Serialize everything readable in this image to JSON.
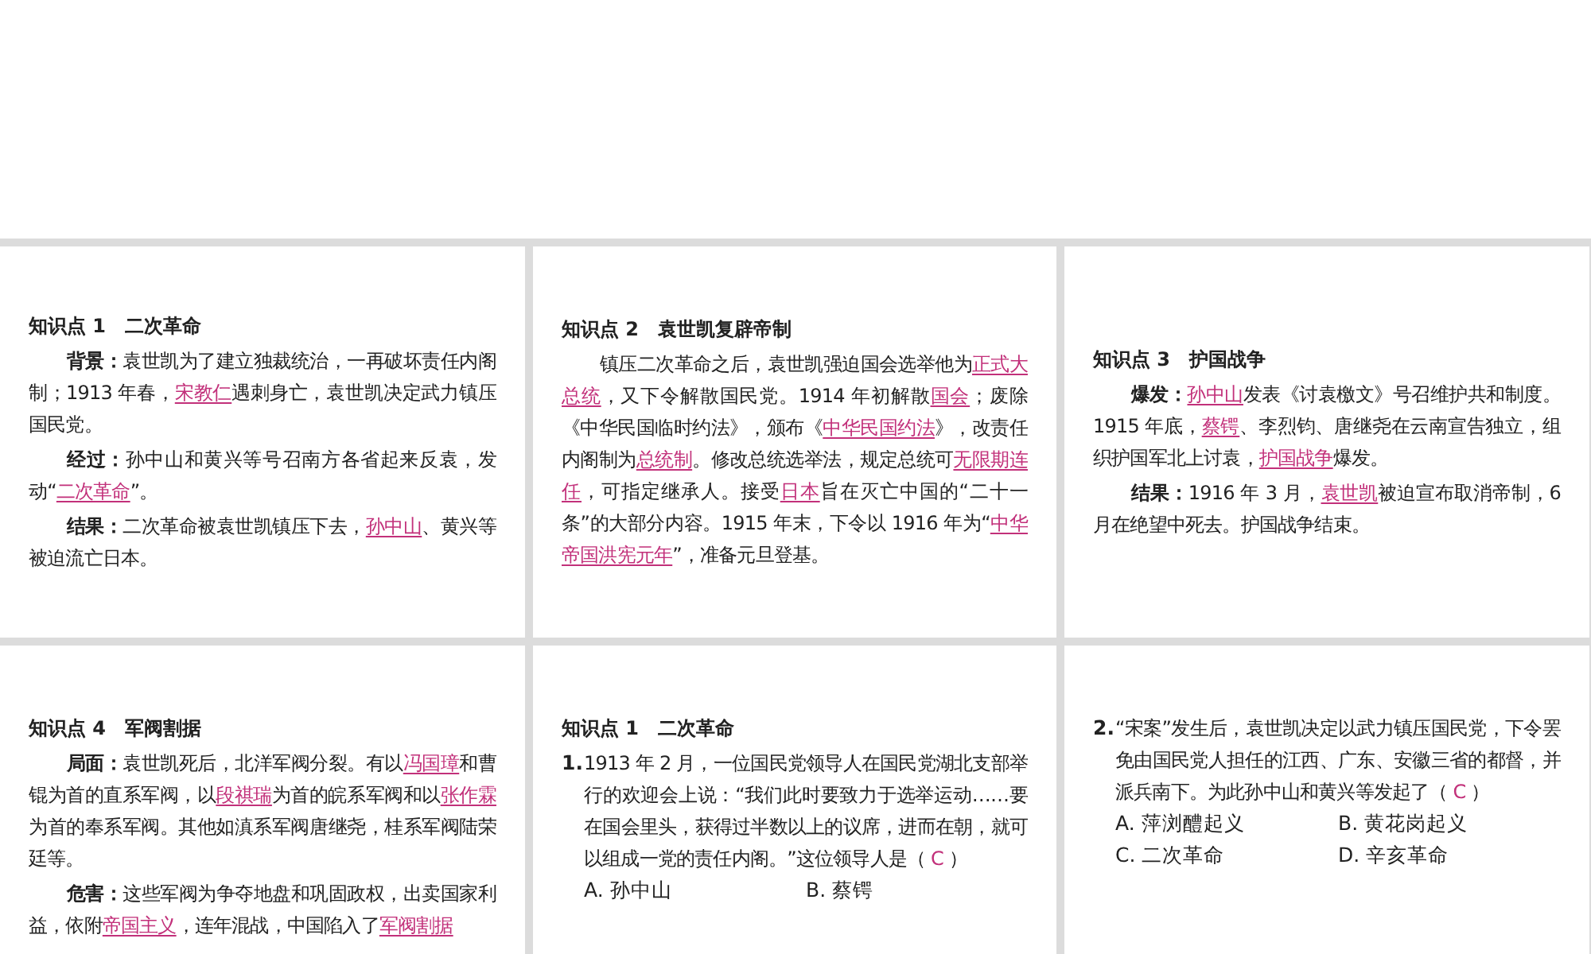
{
  "rows": [
    {
      "kind": "full",
      "panels": [
        {
          "blocks": [
            {
              "kind": "heading",
              "text": "知识点 1　二次革命"
            },
            {
              "kind": "paragraph",
              "segments": [
                {
                  "kind": "lead",
                  "text": "背景："
                },
                {
                  "kind": "plain",
                  "text": "袁世凯为了建立独裁统治，一再破坏责任内阁制；1913 年春，"
                },
                {
                  "kind": "key",
                  "text": "宋教仁"
                },
                {
                  "kind": "plain",
                  "text": "遇刺身亡，袁世凯决定武力镇压国民党。"
                }
              ]
            },
            {
              "kind": "paragraph",
              "segments": [
                {
                  "kind": "lead",
                  "text": "经过："
                },
                {
                  "kind": "plain",
                  "text": "孙中山和黄兴等号召南方各省起来反袁，发动“"
                },
                {
                  "kind": "key",
                  "text": "二次革命"
                },
                {
                  "kind": "plain",
                  "text": "”。"
                }
              ]
            },
            {
              "kind": "paragraph",
              "segments": [
                {
                  "kind": "lead",
                  "text": "结果："
                },
                {
                  "kind": "plain",
                  "text": "二次革命被袁世凯镇压下去，"
                },
                {
                  "kind": "key",
                  "text": "孙中山"
                },
                {
                  "kind": "plain",
                  "text": "、黄兴等被迫流亡日本。"
                }
              ]
            }
          ]
        },
        {
          "blocks": [
            {
              "kind": "heading",
              "text": "知识点 2　袁世凯复辟帝制"
            },
            {
              "kind": "paragraph",
              "segments": [
                {
                  "kind": "plain",
                  "text": "镇压二次革命之后，袁世凯强迫国会选举他为"
                },
                {
                  "kind": "key",
                  "text": "正式大总统"
                },
                {
                  "kind": "plain",
                  "text": "，又下令解散国民党。1914 年初解散"
                },
                {
                  "kind": "key",
                  "text": "国会"
                },
                {
                  "kind": "plain",
                  "text": "；废除《中华民国临时约法》，颁布《"
                },
                {
                  "kind": "key",
                  "text": "中华民国约法"
                },
                {
                  "kind": "plain",
                  "text": "》，改责任内阁制为"
                },
                {
                  "kind": "key",
                  "text": "总统制"
                },
                {
                  "kind": "plain",
                  "text": "。修改总统选举法，规定总统可"
                },
                {
                  "kind": "key",
                  "text": "无限期连任"
                },
                {
                  "kind": "plain",
                  "text": "，可指定继承人。接受"
                },
                {
                  "kind": "key",
                  "text": "日本"
                },
                {
                  "kind": "plain",
                  "text": "旨在灭亡中国的“二十一条”的大部分内容。1915 年末，下令以 1916 年为“"
                },
                {
                  "kind": "key",
                  "text": "中华帝国洪宪元年"
                },
                {
                  "kind": "plain",
                  "text": "”，准备元旦登基。"
                }
              ]
            }
          ]
        },
        {
          "blocks": [
            {
              "kind": "heading",
              "text": "知识点 3　护国战争"
            },
            {
              "kind": "paragraph",
              "segments": [
                {
                  "kind": "lead",
                  "text": "爆发："
                },
                {
                  "kind": "key",
                  "text": "孙中山"
                },
                {
                  "kind": "plain",
                  "text": "发表《讨袁檄文》号召维护共和制度。1915 年底，"
                },
                {
                  "kind": "key",
                  "text": "蔡锷"
                },
                {
                  "kind": "plain",
                  "text": "、李烈钧、唐继尧在云南宣告独立，组织护国军北上讨袁，"
                },
                {
                  "kind": "key",
                  "text": "护国战争"
                },
                {
                  "kind": "plain",
                  "text": "爆发。"
                }
              ]
            },
            {
              "kind": "paragraph",
              "segments": [
                {
                  "kind": "lead",
                  "text": "结果："
                },
                {
                  "kind": "plain",
                  "text": "1916 年 3 月，"
                },
                {
                  "kind": "key",
                  "text": "袁世凯"
                },
                {
                  "kind": "plain",
                  "text": "被迫宣布取消帝制，6 月在绝望中死去。护国战争结束。"
                }
              ]
            }
          ]
        }
      ]
    },
    {
      "kind": "cut",
      "panels": [
        {
          "blocks": [
            {
              "kind": "heading",
              "text": "知识点 4　军阀割据"
            },
            {
              "kind": "paragraph",
              "segments": [
                {
                  "kind": "lead",
                  "text": "局面："
                },
                {
                  "kind": "plain",
                  "text": "袁世凯死后，北洋军阀分裂。有以"
                },
                {
                  "kind": "key",
                  "text": "冯国璋"
                },
                {
                  "kind": "plain",
                  "text": "和曹锟为首的直系军阀，以"
                },
                {
                  "kind": "key",
                  "text": "段祺瑞"
                },
                {
                  "kind": "plain",
                  "text": "为首的皖系军阀和以"
                },
                {
                  "kind": "key",
                  "text": "张作霖"
                },
                {
                  "kind": "plain",
                  "text": "为首的奉系军阀。其他如滇系军阀唐继尧，桂系军阀陆荣廷等。"
                }
              ]
            },
            {
              "kind": "paragraph",
              "segments": [
                {
                  "kind": "lead",
                  "text": "危害："
                },
                {
                  "kind": "plain",
                  "text": "这些军阀为争夺地盘和巩固政权，出卖国家利益，依附"
                },
                {
                  "kind": "key",
                  "text": "帝国主义"
                },
                {
                  "kind": "plain",
                  "text": "，连年混战，中国陷入了"
                },
                {
                  "kind": "key",
                  "text": "军阀割据"
                }
              ]
            }
          ]
        },
        {
          "blocks": [
            {
              "kind": "heading",
              "text": "知识点 1　二次革命"
            },
            {
              "kind": "question",
              "number": "1.",
              "segments": [
                {
                  "kind": "plain",
                  "text": "1913 年 2 月，一位国民党领导人在国民党湖北支部举行的欢迎会上说：“我们此时要致力于选举运动……要在国会里头，获得过半数以上的议席，进而在朝，就可以组成一党的责任内阁。”这位领导人是（ "
                },
                {
                  "kind": "answer",
                  "text": "C"
                },
                {
                  "kind": "plain",
                  "text": " ）"
                }
              ],
              "options": [
                "A. 孙中山",
                "B. 蔡锷"
              ]
            }
          ]
        },
        {
          "blocks": [
            {
              "kind": "question",
              "number": "2.",
              "segments": [
                {
                  "kind": "plain",
                  "text": "“宋案”发生后，袁世凯决定以武力镇压国民党，下令罢免由国民党人担任的江西、广东、安徽三省的都督，并派兵南下。为此孙中山和黄兴等发起了（ "
                },
                {
                  "kind": "answer",
                  "text": "C"
                },
                {
                  "kind": "plain",
                  "text": " ）"
                }
              ],
              "options": [
                "A. 萍浏醴起义",
                "B. 黄花岗起义",
                "C. 二次革命",
                "D. 辛亥革命"
              ]
            }
          ]
        }
      ]
    }
  ]
}
